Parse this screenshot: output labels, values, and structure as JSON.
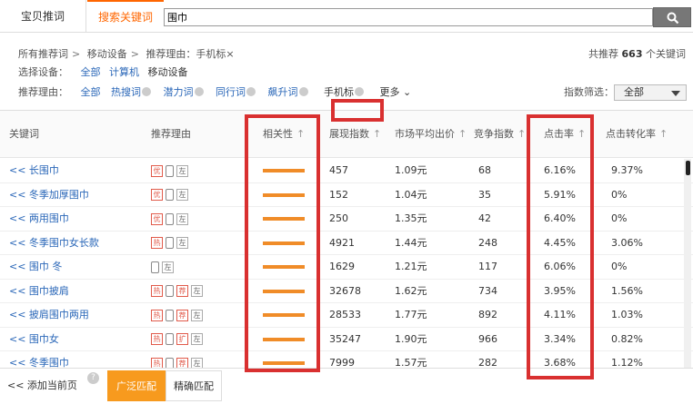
{
  "tabs": [
    "宝贝推词",
    "搜索关键词"
  ],
  "search": {
    "value": "围巾"
  },
  "breadcrumb": [
    "所有推荐词",
    "移动设备",
    "推荐理由：手机标×"
  ],
  "total": {
    "prefix": "共推荐",
    "count": "663",
    "suffix": "个关键词"
  },
  "device": {
    "label": "选择设备：",
    "options": [
      "全部",
      "计算机",
      "移动设备"
    ]
  },
  "reason": {
    "label": "推荐理由：",
    "options": [
      "全部",
      "热搜词",
      "潜力词",
      "同行词",
      "飙升词",
      "手机标"
    ],
    "more": "更多"
  },
  "index_filter": {
    "label": "指数筛选：",
    "value": "全部"
  },
  "columns": [
    "关键词",
    "推荐理由",
    "相关性",
    "展现指数",
    "市场平均出价",
    "竞争指数",
    "点击率",
    "点击转化率"
  ],
  "rows": [
    {
      "kw": "<< 长围巾",
      "tags": [
        "优",
        "phone",
        "左"
      ],
      "show": "457",
      "bid": "1.09元",
      "comp": "68",
      "ctr": "6.16%",
      "cvr": "9.37%"
    },
    {
      "kw": "<< 冬季加厚围巾",
      "tags": [
        "优",
        "phone",
        "左"
      ],
      "show": "152",
      "bid": "1.04元",
      "comp": "35",
      "ctr": "5.91%",
      "cvr": "0%"
    },
    {
      "kw": "<< 两用围巾",
      "tags": [
        "优",
        "phone",
        "左"
      ],
      "show": "250",
      "bid": "1.35元",
      "comp": "42",
      "ctr": "6.40%",
      "cvr": "0%"
    },
    {
      "kw": "<< 冬季围巾女长款",
      "tags": [
        "热",
        "phone",
        "左"
      ],
      "show": "4921",
      "bid": "1.44元",
      "comp": "248",
      "ctr": "4.45%",
      "cvr": "3.06%"
    },
    {
      "kw": "<< 围巾 冬",
      "tags": [
        "phone",
        "左"
      ],
      "show": "1629",
      "bid": "1.21元",
      "comp": "117",
      "ctr": "6.06%",
      "cvr": "0%"
    },
    {
      "kw": "<< 围巾披肩",
      "tags": [
        "热",
        "phone",
        "荐",
        "左"
      ],
      "show": "32678",
      "bid": "1.62元",
      "comp": "734",
      "ctr": "3.95%",
      "cvr": "1.56%"
    },
    {
      "kw": "<< 披肩围巾两用",
      "tags": [
        "热",
        "phone",
        "荐",
        "左"
      ],
      "show": "28533",
      "bid": "1.77元",
      "comp": "892",
      "ctr": "4.11%",
      "cvr": "1.03%"
    },
    {
      "kw": "<< 围巾女",
      "tags": [
        "热",
        "phone",
        "扩",
        "左"
      ],
      "show": "35247",
      "bid": "1.90元",
      "comp": "966",
      "ctr": "3.34%",
      "cvr": "0.82%"
    },
    {
      "kw": "<< 冬季围巾",
      "tags": [
        "热",
        "phone",
        "荐",
        "左"
      ],
      "show": "7999",
      "bid": "1.57元",
      "comp": "282",
      "ctr": "3.68%",
      "cvr": "1.12%"
    }
  ],
  "bottom": {
    "add_label": "<< 添加当前页",
    "help": "?",
    "broad": "广泛匹配",
    "exact": "精确匹配"
  },
  "colors": {
    "accent": "#f60",
    "link": "#2a67b8",
    "highlight": "#d93030",
    "relevance_bar": "#f08c28"
  }
}
